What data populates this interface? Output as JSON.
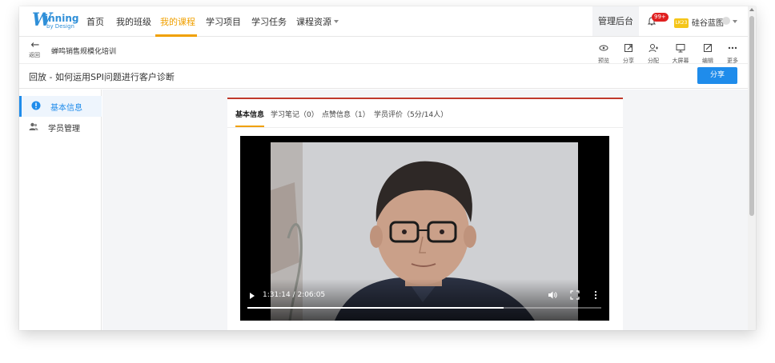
{
  "nav": {
    "logo_main": "inning",
    "logo_initial": "W",
    "logo_sub": "by Design",
    "items": [
      "首页",
      "我的班级",
      "我的课程",
      "学习项目",
      "学习任务",
      "课程资源"
    ],
    "active_index": 2,
    "admin_label": "管理后台",
    "badge": "99+",
    "org_icon_text": "LK23",
    "org_name": "硅谷蓝图"
  },
  "subbar": {
    "back_label": "返回",
    "course_name": "蝉鸣销售规模化培训",
    "tools": [
      {
        "icon": "eye-icon",
        "label": "预览"
      },
      {
        "icon": "share-icon",
        "label": "分享"
      },
      {
        "icon": "assign-icon",
        "label": "分配"
      },
      {
        "icon": "monitor-icon",
        "label": "大屏幕"
      },
      {
        "icon": "edit-icon",
        "label": "编辑"
      },
      {
        "icon": "more-icon",
        "label": "更多"
      }
    ]
  },
  "titlebar": {
    "title": "回放 - 如何运用SPI问题进行客户诊断",
    "share_button": "分享"
  },
  "sidebar": {
    "items": [
      {
        "icon": "info-icon",
        "label": "基本信息",
        "active": true
      },
      {
        "icon": "users-icon",
        "label": "学员管理",
        "active": false
      }
    ]
  },
  "panel": {
    "tabs": [
      "基本信息",
      "学习笔记（0）",
      "点赞信息（1）",
      "学员评价（5分/14人）"
    ],
    "active_tab": 0
  },
  "video": {
    "time_display": "1:31:14 / 2:06:05",
    "progress_fraction": 0.724
  },
  "colors": {
    "accent_orange": "#f0a000",
    "primary_blue": "#1f8ceb",
    "panel_top_red": "#c0392b"
  }
}
